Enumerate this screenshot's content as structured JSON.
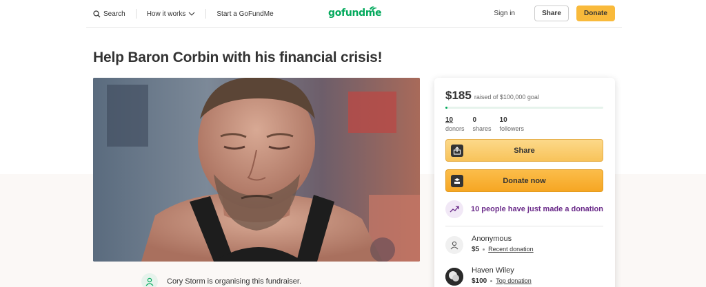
{
  "header": {
    "search_label": "Search",
    "how_label": "How it works",
    "start_label": "Start a GoFundMe",
    "logo_text": "gofundme",
    "signin_label": "Sign in",
    "share_label": "Share",
    "donate_label": "Donate"
  },
  "campaign": {
    "title": "Help Baron Corbin with his financial crisis!",
    "organiser_text": "Cory Storm is organising this fundraiser."
  },
  "card": {
    "raised_amount": "$185",
    "goal_text": "raised of $100,000 goal",
    "progress_fraction": 0.00185,
    "stats": [
      {
        "num": "10",
        "label": "donors"
      },
      {
        "num": "0",
        "label": "shares"
      },
      {
        "num": "10",
        "label": "followers"
      }
    ],
    "share_label": "Share",
    "donate_label": "Donate now",
    "trend_text": "10 people have just made a donation",
    "donations": [
      {
        "name": "Anonymous",
        "amount": "$5",
        "tag": "Recent donation"
      },
      {
        "name": "Haven Wiley",
        "amount": "$100",
        "tag": "Top donation"
      }
    ]
  },
  "colors": {
    "brand": "#02a95c",
    "donate": "#f9ba3b",
    "trend": "#6b2c8a"
  }
}
